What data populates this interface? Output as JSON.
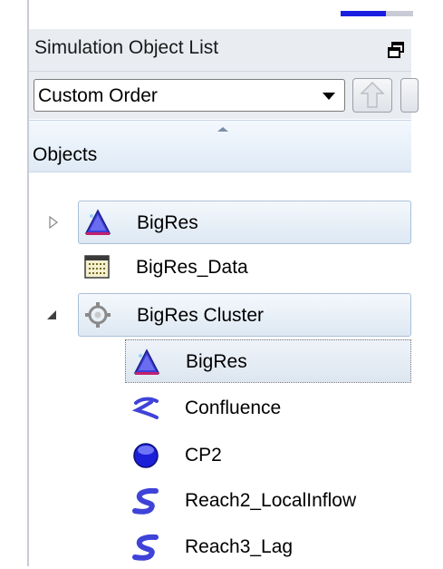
{
  "panel": {
    "title": "Simulation Object List",
    "order_dropdown": {
      "value": "Custom Order"
    },
    "column_header": "Objects"
  },
  "tree": [
    {
      "label": "BigRes",
      "icon": "reservoir-icon",
      "expander": "collapsed"
    },
    {
      "label": "BigRes_Data",
      "icon": "data-table-icon"
    },
    {
      "label": "BigRes Cluster",
      "icon": "cluster-gear-icon",
      "expander": "expanded"
    },
    {
      "label": "BigRes",
      "icon": "reservoir-icon"
    },
    {
      "label": "Confluence",
      "icon": "confluence-icon"
    },
    {
      "label": "CP2",
      "icon": "control-point-icon"
    },
    {
      "label": "Reach2_LocalInflow",
      "icon": "reach-icon"
    },
    {
      "label": "Reach3_Lag",
      "icon": "reach-icon"
    }
  ],
  "colors": {
    "selection": "#dde8f3",
    "accent_blue": "#1a1ee0"
  }
}
